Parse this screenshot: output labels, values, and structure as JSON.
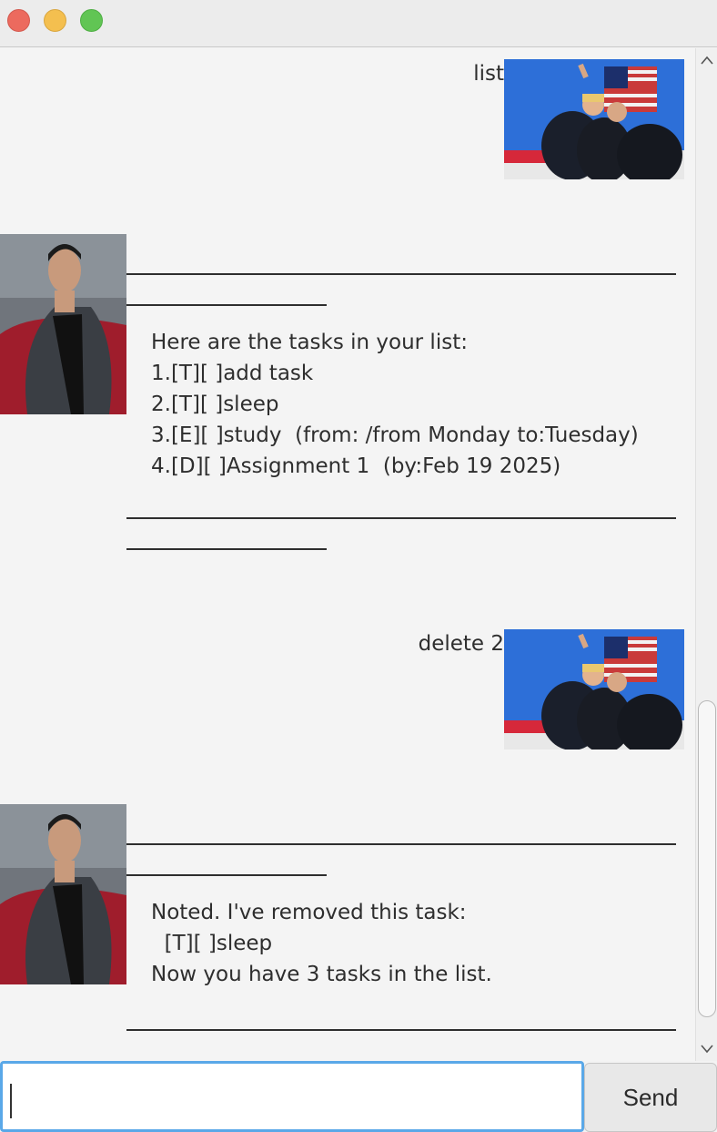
{
  "window": {
    "controls": [
      "close",
      "minimize",
      "maximize"
    ]
  },
  "chat": {
    "messages": [
      {
        "sender": "user",
        "text": "list"
      },
      {
        "sender": "bot",
        "lines": [
          "Here are the tasks in your list:",
          "1.[T][ ]add task",
          "2.[T][ ]sleep",
          "3.[E][ ]study  (from: /from Monday to:Tuesday)",
          "4.[D][ ]Assignment 1  (by:Feb 19 2025)"
        ]
      },
      {
        "sender": "user",
        "text": "delete 2"
      },
      {
        "sender": "bot",
        "lines": [
          "Noted. I've removed this task:",
          "  [T][ ]sleep",
          "Now you have 3 tasks in the list."
        ]
      }
    ]
  },
  "input": {
    "value": ""
  },
  "send_button": {
    "label": "Send"
  },
  "colors": {
    "input_focus": "#5aa8e8",
    "background": "#f4f4f4"
  },
  "icons": {
    "scroll_up": "chevron-up-icon",
    "scroll_down": "chevron-down-icon"
  }
}
